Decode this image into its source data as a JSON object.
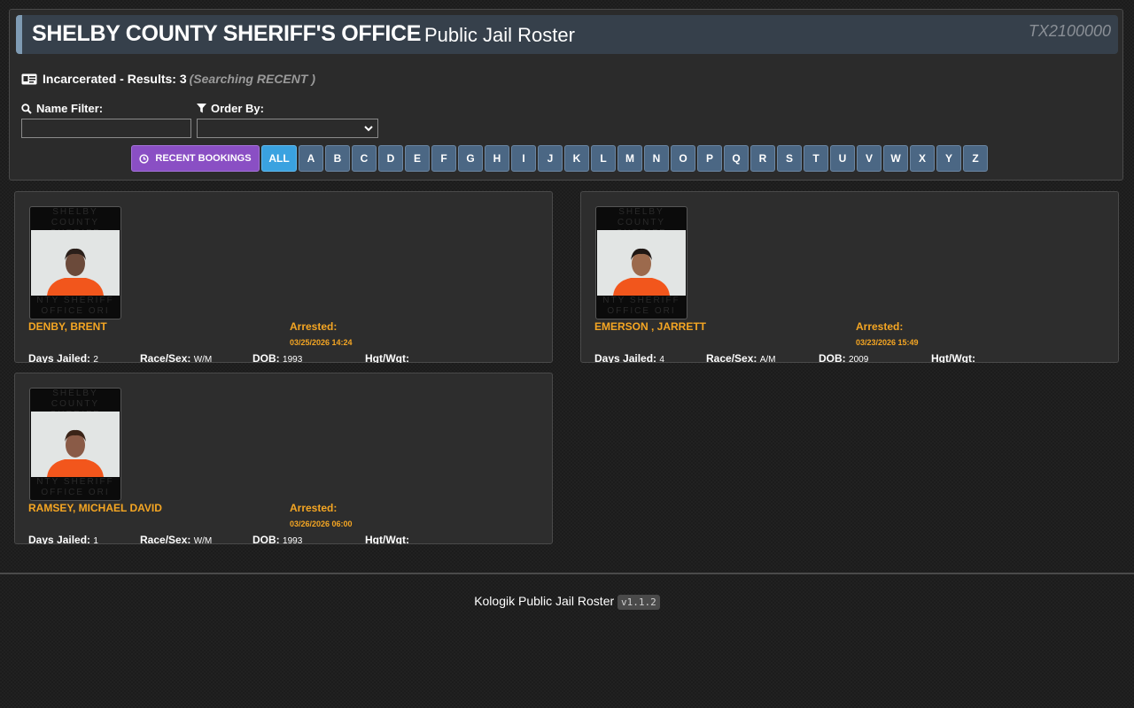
{
  "header": {
    "agency": "SHELBY COUNTY SHERIFF'S OFFICE",
    "title": "Public Jail Roster",
    "ori": "TX2100000"
  },
  "results": {
    "label": "Incarcerated - Results: 3",
    "searching": "(Searching RECENT )"
  },
  "filters": {
    "name_label": "Name Filter:",
    "name_value": "",
    "order_label": "Order By:",
    "order_value": ""
  },
  "letters": {
    "recent_label": "RECENT BOOKINGS",
    "all_label": "ALL",
    "items": [
      "A",
      "B",
      "C",
      "D",
      "E",
      "F",
      "G",
      "H",
      "I",
      "J",
      "K",
      "L",
      "M",
      "N",
      "O",
      "P",
      "Q",
      "R",
      "S",
      "T",
      "U",
      "V",
      "W",
      "X",
      "Y",
      "Z"
    ]
  },
  "labels": {
    "arrested": "Arrested:",
    "days_jailed": "Days Jailed:",
    "race_sex": "Race/Sex:",
    "dob": "DOB:",
    "hgt_wgt": "Hgt/Wgt:"
  },
  "photo_banner": {
    "top": "SHELBY COUNTY SHERIFF",
    "bottom": "NTY SHERIFF OFFICE ORI"
  },
  "inmates": [
    {
      "name": "DENBY, BRENT",
      "arrested": "03/25/2026 14:24",
      "days_jailed": "2",
      "race_sex": "W/M",
      "dob": "1993",
      "hgt_wgt": ""
    },
    {
      "name": "EMERSON , JARRETT",
      "arrested": "03/23/2026 15:49",
      "days_jailed": "4",
      "race_sex": "A/M",
      "dob": "2009",
      "hgt_wgt": ""
    },
    {
      "name": "RAMSEY, MICHAEL DAVID",
      "arrested": "03/26/2026 06:00",
      "days_jailed": "1",
      "race_sex": "W/M",
      "dob": "1993",
      "hgt_wgt": ""
    }
  ],
  "footer": {
    "text": "Kologik Public Jail Roster",
    "version": "v1.1.2"
  },
  "colors": {
    "accent_orange": "#f5a623",
    "recent_purple": "#8a4fc4",
    "letter_blue": "#4b6784",
    "active_blue": "#3aa2e0",
    "jumpsuit_orange": "#f2561c"
  }
}
